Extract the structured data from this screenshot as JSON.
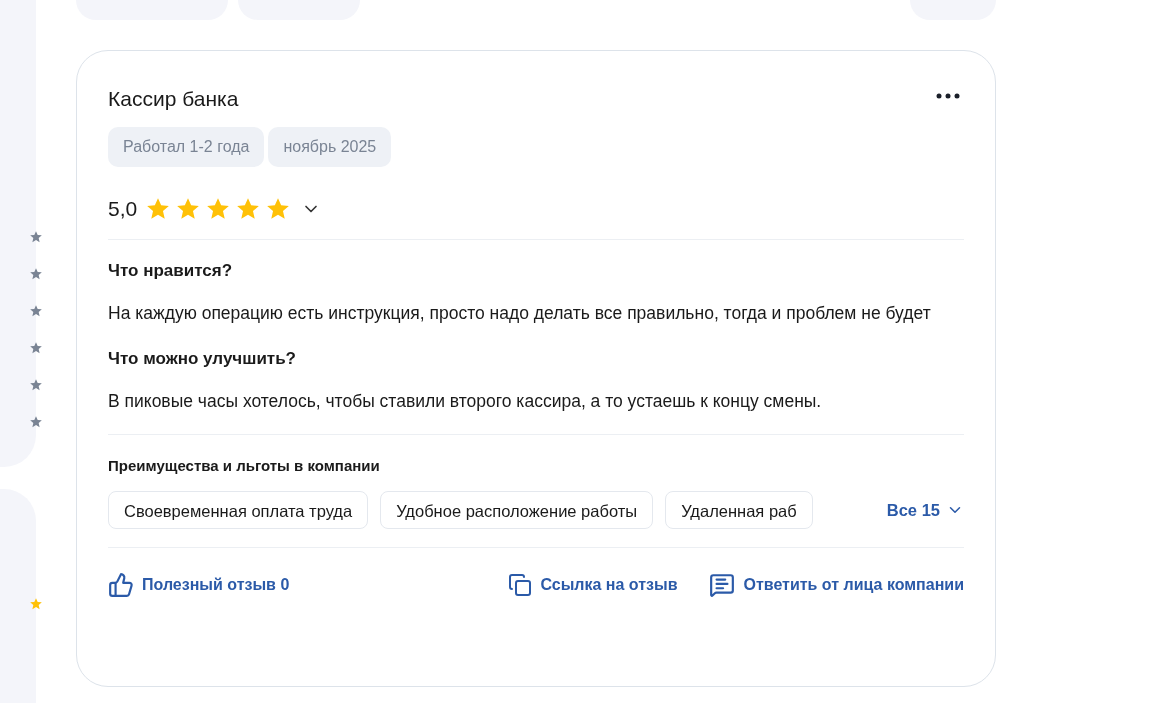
{
  "review": {
    "title": "Кассир банка",
    "tags": [
      "Работал 1-2 года",
      "ноябрь 2025"
    ],
    "rating": "5,0",
    "stars": 5,
    "sections": [
      {
        "heading": "Что нравится?",
        "text": "На каждую операцию есть инструкция, просто надо делать все правильно, тогда и проблем не будет"
      },
      {
        "heading": "Что можно улучшить?",
        "text": "В пиковые часы хотелось, чтобы ставили второго кассира, а то устаешь к концу смены."
      }
    ],
    "benefits": {
      "heading": "Преимущества и льготы в компании",
      "items": [
        "Своевременная оплата труда",
        "Удобное расположение работы",
        "Удаленная раб"
      ],
      "more": "Все 15"
    },
    "actions": {
      "helpful": "Полезный отзыв 0",
      "link": "Ссылка на отзыв",
      "reply": "Ответить от лица компании"
    }
  }
}
